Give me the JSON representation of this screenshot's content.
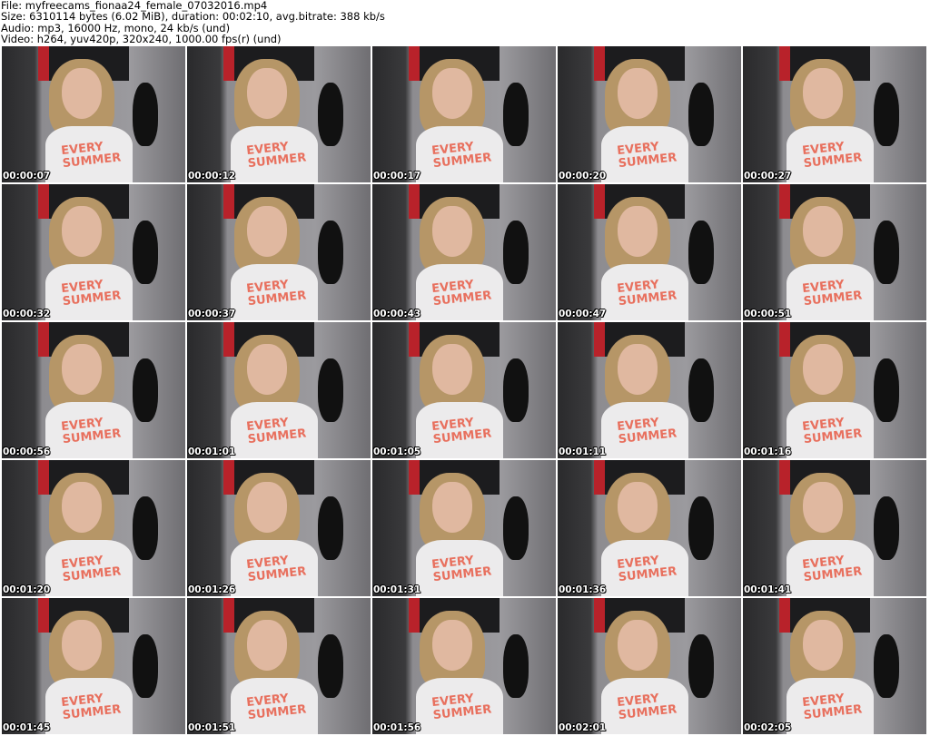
{
  "header": {
    "file": "File: myfreecams_fionaa24_female_07032016.mp4",
    "size": "Size: 6310114 bytes (6.02 MiB), duration: 00:02:10, avg.bitrate: 388 kb/s",
    "audio": "Audio: mp3, 16000 Hz, mono, 24 kb/s (und)",
    "video": "Video: h264, yuv420p, 320x240, 1000.00 fps(r) (und)"
  },
  "thumbnails": [
    {
      "time": "00:00:07"
    },
    {
      "time": "00:00:12"
    },
    {
      "time": "00:00:17"
    },
    {
      "time": "00:00:20"
    },
    {
      "time": "00:00:27"
    },
    {
      "time": "00:00:32"
    },
    {
      "time": "00:00:37"
    },
    {
      "time": "00:00:43"
    },
    {
      "time": "00:00:47"
    },
    {
      "time": "00:00:51"
    },
    {
      "time": "00:00:56"
    },
    {
      "time": "00:01:01"
    },
    {
      "time": "00:01:05"
    },
    {
      "time": "00:01:11"
    },
    {
      "time": "00:01:16"
    },
    {
      "time": "00:01:20"
    },
    {
      "time": "00:01:26"
    },
    {
      "time": "00:01:31"
    },
    {
      "time": "00:01:36"
    },
    {
      "time": "00:01:41"
    },
    {
      "time": "00:01:45"
    },
    {
      "time": "00:01:51"
    },
    {
      "time": "00:01:56"
    },
    {
      "time": "00:02:01"
    },
    {
      "time": "00:02:05"
    }
  ]
}
